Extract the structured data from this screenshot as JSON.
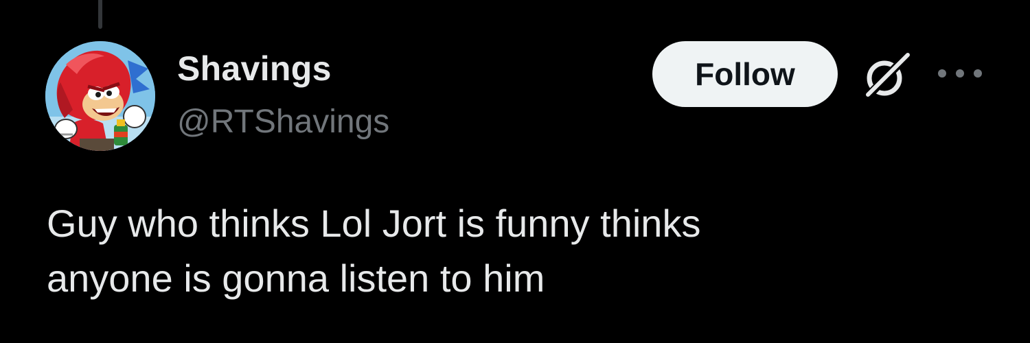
{
  "colors": {
    "background": "#000000",
    "primary_text": "#e7e9ea",
    "secondary_text": "#71767b",
    "follow_button_bg": "#eff3f4",
    "follow_button_text": "#0f1419"
  },
  "author": {
    "display_name": "Shavings",
    "handle": "@RTShavings",
    "avatar_icon": "knuckles-avatar"
  },
  "actions": {
    "follow_label": "Follow",
    "grok_icon": "grok-icon",
    "more_icon": "more-options-icon"
  },
  "tweet": {
    "lines": [
      "Guy who thinks Lol Jort is funny thinks",
      "anyone is gonna listen to him"
    ]
  }
}
